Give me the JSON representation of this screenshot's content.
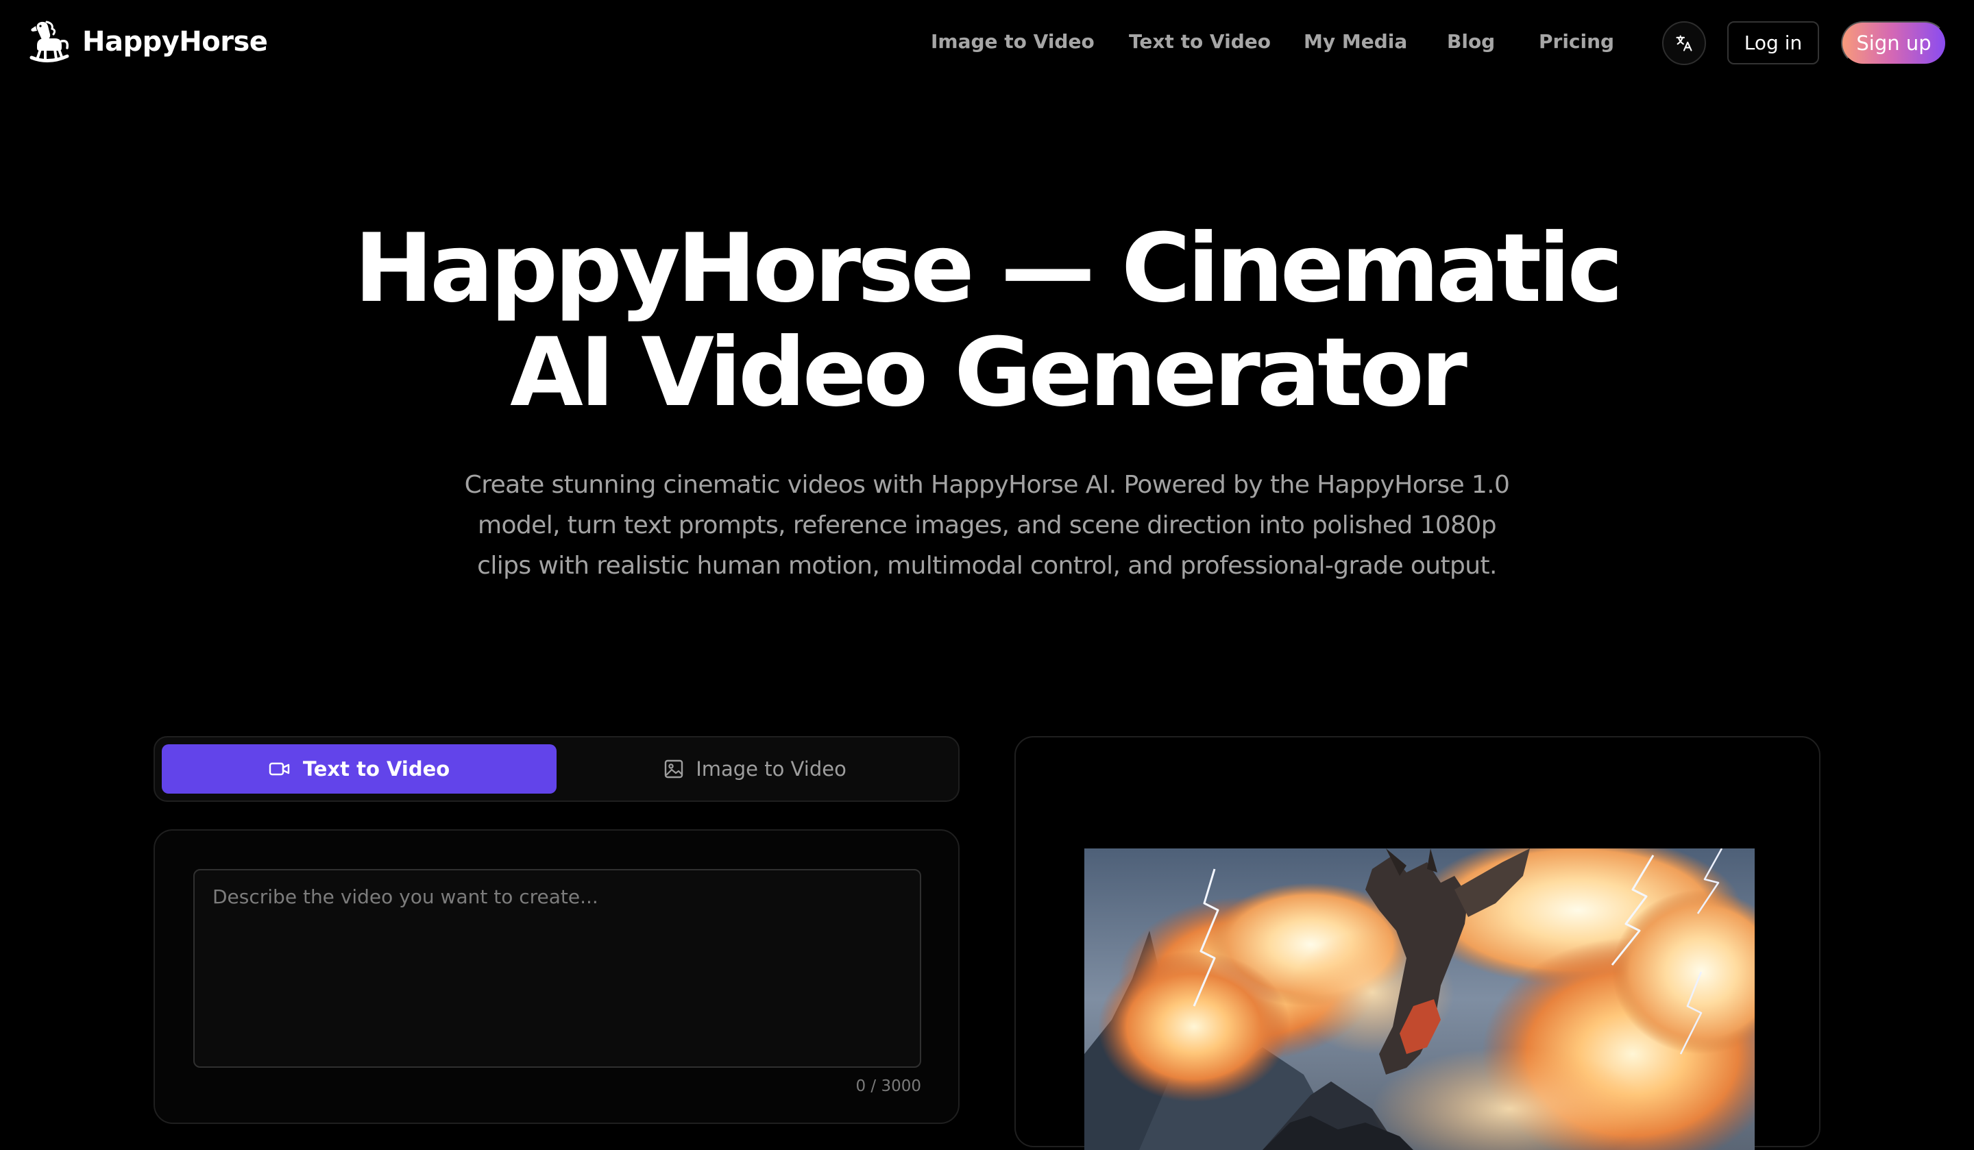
{
  "brand": {
    "name": "HappyHorse",
    "logo_icon": "rocking-horse-icon"
  },
  "nav": {
    "items": [
      {
        "label": "Image to Video"
      },
      {
        "label": "Text to Video"
      },
      {
        "label": "My Media"
      },
      {
        "label": "Blog"
      },
      {
        "label": "Pricing"
      }
    ],
    "language_icon": "translate-icon",
    "login_label": "Log in",
    "signup_label": "Sign up"
  },
  "hero": {
    "title_line1": "HappyHorse — Cinematic",
    "title_line2": "AI Video Generator",
    "subtitle": "Create stunning cinematic videos with HappyHorse AI. Powered by the HappyHorse 1.0 model, turn text prompts, reference images, and scene direction into polished 1080p clips with realistic human motion, multimodal control, and professional-grade output."
  },
  "generator": {
    "tabs": [
      {
        "label": "Text to Video",
        "icon": "video-camera-icon",
        "active": true
      },
      {
        "label": "Image to Video",
        "icon": "image-icon",
        "active": false
      }
    ],
    "prompt": {
      "value": "",
      "placeholder": "Describe the video you want to create...",
      "char_count": "0 / 3000"
    }
  },
  "preview": {
    "media_subject": "dragon breathing fire with lightning over mountains"
  },
  "colors": {
    "background": "#000000",
    "accent": "#6244ea",
    "nav_text": "#a6a6a6",
    "signup_gradient": [
      "#f79a7b",
      "#d468b4",
      "#8a4cf0"
    ]
  }
}
